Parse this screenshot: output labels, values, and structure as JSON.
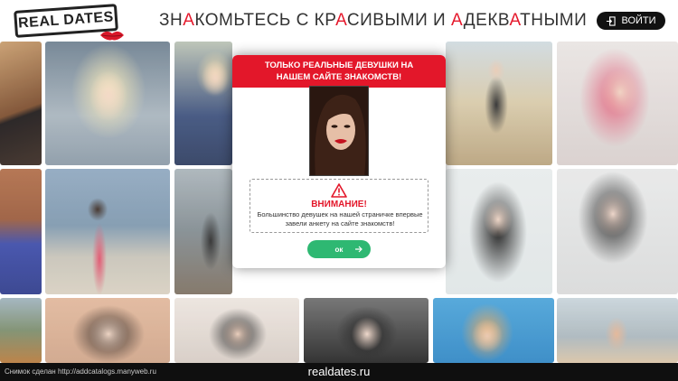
{
  "header": {
    "logo_text": "REAL DATES",
    "headline_parts": [
      {
        "t": "ЗН",
        "red": false
      },
      {
        "t": "А",
        "red": true
      },
      {
        "t": "КОМЬТЕСЬ С КР",
        "red": false
      },
      {
        "t": "А",
        "red": true
      },
      {
        "t": "СИВЫМИ И ",
        "red": false
      },
      {
        "t": "А",
        "red": true
      },
      {
        "t": "ДЕКВ",
        "red": false
      },
      {
        "t": "А",
        "red": true
      },
      {
        "t": "ТНЫМИ",
        "red": false
      }
    ],
    "login_label": "ВОЙТИ"
  },
  "modal": {
    "title": "ТОЛЬКО РЕАЛЬНЫЕ ДЕВУШКИ НА НАШЕМ САЙТЕ ЗНАКОМСТВ!",
    "warning_title": "ВНИМАНИЕ!",
    "warning_text": "Большинство девушек на нашей страничке впервые завели анкету на сайте знакомств!",
    "ok_label": "ок"
  },
  "colors": {
    "accent_red": "#e3172a",
    "ok_green": "#2eb872",
    "login_bg": "#111111"
  },
  "footer": {
    "screenshot_note": "Снимок сделан http://addcatalogs.manyweb.ru",
    "site": "realdates.ru"
  }
}
